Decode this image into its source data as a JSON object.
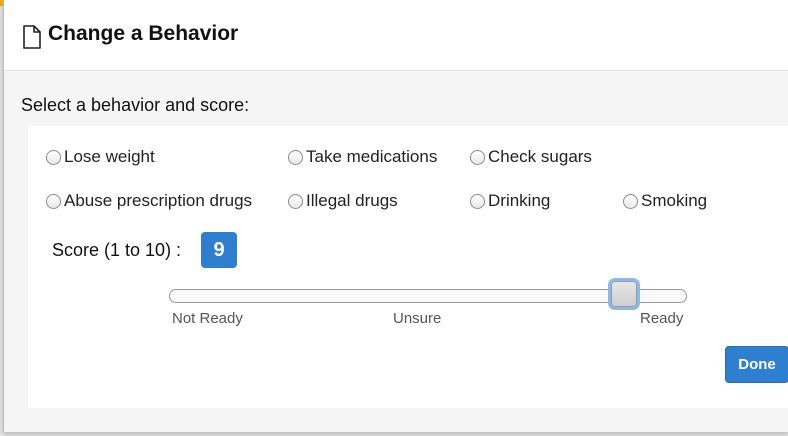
{
  "dialog": {
    "title": "Change a Behavior",
    "prompt": "Select a behavior and score:"
  },
  "behaviors": [
    {
      "label": "Lose weight",
      "selected": false
    },
    {
      "label": "Take medications",
      "selected": false
    },
    {
      "label": "Check sugars",
      "selected": false
    },
    {
      "label": "Abuse prescription drugs",
      "selected": false
    },
    {
      "label": "Illegal drugs",
      "selected": false
    },
    {
      "label": "Drinking",
      "selected": false
    },
    {
      "label": "Smoking",
      "selected": false
    }
  ],
  "score": {
    "label": "Score (1 to 10) :",
    "value": "9",
    "min": 1,
    "max": 10,
    "tick_labels": [
      "Not Ready",
      "Unsure",
      "Ready"
    ]
  },
  "actions": {
    "done_label": "Done"
  },
  "colors": {
    "accent": "#2f7fd0",
    "focus_ring": "#8ab9f0"
  },
  "icons": {
    "title_icon": "document-icon"
  }
}
